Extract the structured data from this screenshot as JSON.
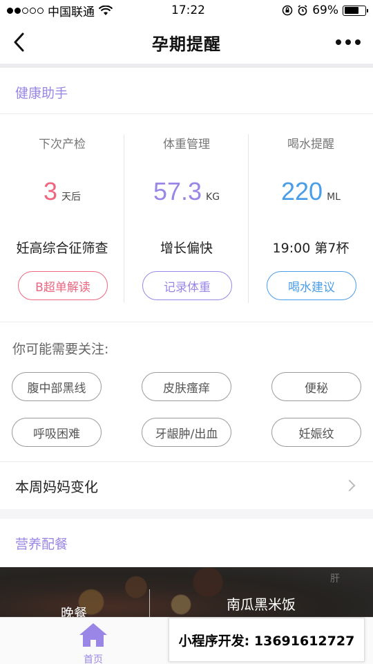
{
  "status_bar": {
    "carrier": "中国联通",
    "time": "17:22",
    "battery_percent": "69%",
    "battery_level": 0.69
  },
  "nav": {
    "title": "孕期提醒"
  },
  "health": {
    "title": "健康助手",
    "columns": [
      {
        "label": "下次产检",
        "value": "3",
        "unit": "天后",
        "desc": "妊高综合征筛查",
        "button": "B超单解读",
        "color": "#ee6680"
      },
      {
        "label": "体重管理",
        "value": "57.3",
        "unit": "KG",
        "desc": "增长偏快",
        "button": "记录体重",
        "color": "#9a86e6"
      },
      {
        "label": "喝水提醒",
        "value": "220",
        "unit": "ML",
        "desc": "19:00 第7杯",
        "button": "喝水建议",
        "color": "#4a9de8"
      }
    ],
    "attention_title": "你可能需要关注:",
    "tags": [
      "腹中部黑线",
      "皮肤瘙痒",
      "便秘",
      "呼吸困难",
      "牙龈肿/出血",
      "妊娠纹"
    ],
    "week_change": "本周妈妈变化"
  },
  "nutrition": {
    "title": "营养配餐",
    "meal": "晚餐",
    "dish": "南瓜黑米饭",
    "faint": "肝"
  },
  "tab_bar": {
    "home_label": "首页",
    "ad_text": "小程序开发: 13691612727"
  },
  "colors": {
    "accent": "#9a86e6",
    "pink": "#ee6680",
    "blue": "#4a9de8"
  }
}
